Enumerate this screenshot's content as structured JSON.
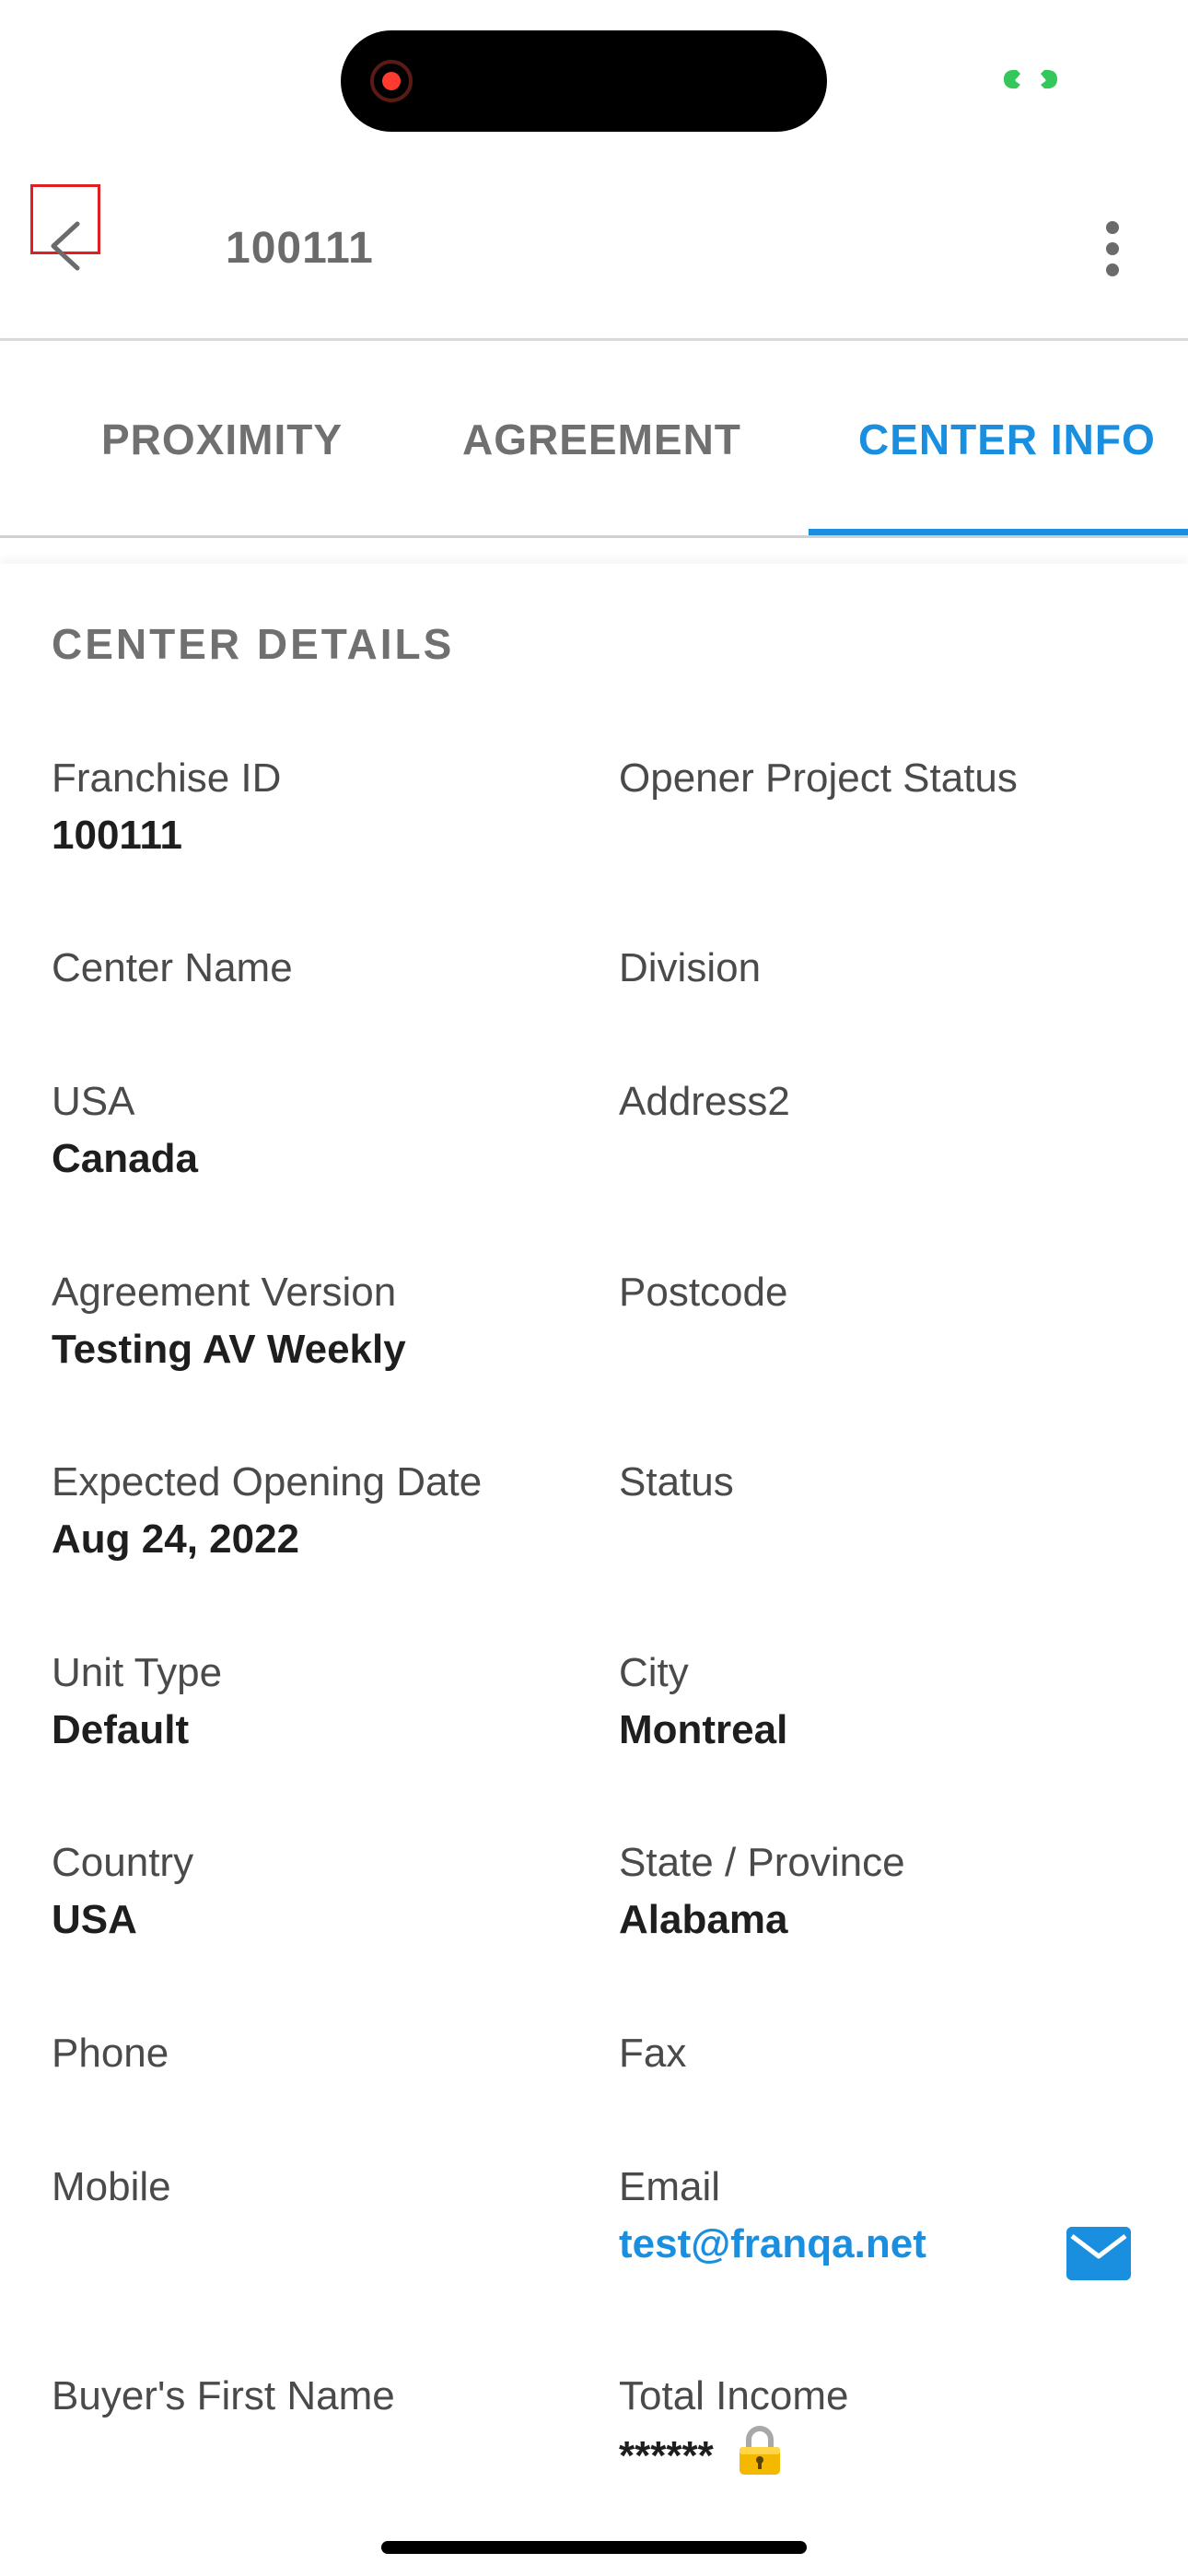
{
  "header": {
    "title": "100111"
  },
  "tabs": [
    {
      "label": "PROXIMITY",
      "active": false
    },
    {
      "label": "AGREEMENT",
      "active": false
    },
    {
      "label": "CENTER INFO",
      "active": true
    }
  ],
  "section": {
    "title": "CENTER DETAILS"
  },
  "fields": {
    "franchise_id": {
      "label": "Franchise ID",
      "value": "100111"
    },
    "opener_project_status": {
      "label": "Opener Project Status",
      "value": ""
    },
    "center_name": {
      "label": "Center Name",
      "value": ""
    },
    "division": {
      "label": "Division",
      "value": ""
    },
    "usa": {
      "label": "USA",
      "value": "Canada"
    },
    "address2": {
      "label": "Address2",
      "value": ""
    },
    "agreement_version": {
      "label": "Agreement Version",
      "value": "Testing AV Weekly"
    },
    "postcode": {
      "label": "Postcode",
      "value": ""
    },
    "expected_opening_date": {
      "label": "Expected Opening Date",
      "value": "Aug 24, 2022"
    },
    "status": {
      "label": "Status",
      "value": ""
    },
    "unit_type": {
      "label": "Unit Type",
      "value": "Default"
    },
    "city": {
      "label": "City",
      "value": "Montreal"
    },
    "country": {
      "label": "Country",
      "value": "USA"
    },
    "state_province": {
      "label": "State / Province",
      "value": "Alabama"
    },
    "phone": {
      "label": "Phone",
      "value": ""
    },
    "fax": {
      "label": "Fax",
      "value": ""
    },
    "mobile": {
      "label": "Mobile",
      "value": ""
    },
    "email": {
      "label": "Email",
      "value": "test@franqa.net"
    },
    "buyers_first_name": {
      "label": "Buyer's First Name",
      "value": ""
    },
    "total_income": {
      "label": "Total Income",
      "value": "******"
    }
  },
  "icons": {
    "back": "back-arrow-icon",
    "more": "more-vertical-icon",
    "mail": "mail-icon",
    "lock": "lock-icon"
  },
  "colors": {
    "accent": "#1a8fe0",
    "back_highlight": "#e02020"
  }
}
